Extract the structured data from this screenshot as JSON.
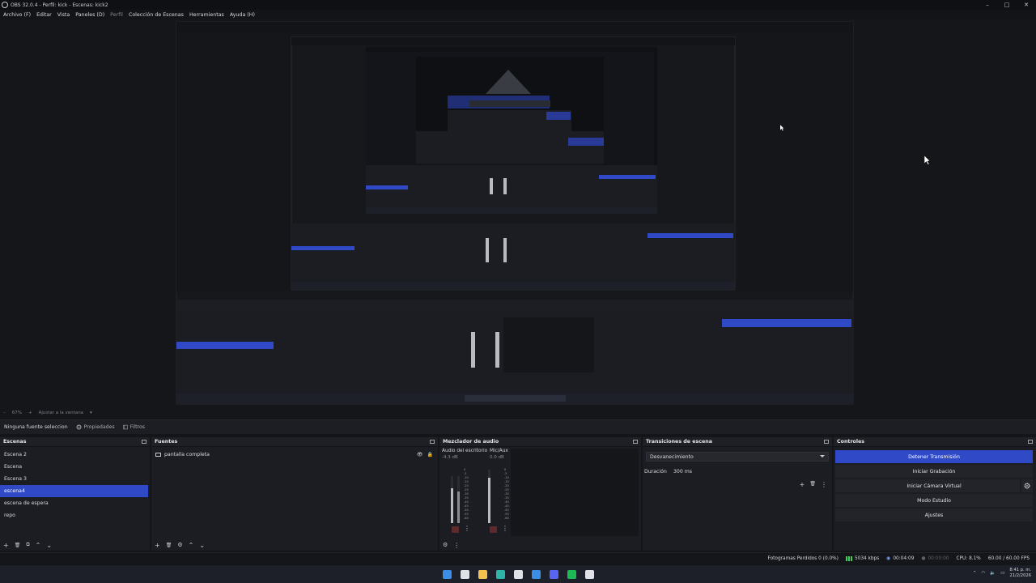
{
  "window": {
    "title": "OBS 32.0.4 - Perfil: kick - Escenas: kick2",
    "controls": {
      "minimize": "–",
      "maximize": "□",
      "close": "✕"
    }
  },
  "menu": {
    "items": [
      "Archivo (F)",
      "Editar",
      "Vista",
      "Paneles (D)",
      "Perfil",
      "Colección de Escenas",
      "Herramientas",
      "Ayuda (H)"
    ]
  },
  "preview_bar": {
    "zoom": "67%",
    "fit_label": "Ajustar a la ventana"
  },
  "context_bar": {
    "no_source": "Ninguna fuente seleccion",
    "properties": "Propiedades",
    "filters": "Filtros"
  },
  "scenes": {
    "title": "Escenas",
    "items": [
      {
        "label": "Escena 2",
        "selected": false
      },
      {
        "label": "Escena",
        "selected": false
      },
      {
        "label": "Escena 3",
        "selected": false
      },
      {
        "label": "escena4",
        "selected": true
      },
      {
        "label": "escena de espera",
        "selected": false
      },
      {
        "label": "repo",
        "selected": false
      }
    ],
    "footer": [
      "+",
      "🗑",
      "⧉",
      "⌃",
      "⌄"
    ]
  },
  "sources": {
    "title": "Fuentes",
    "items": [
      {
        "label": "pantalla completa",
        "icon": "monitor-icon"
      }
    ],
    "row_icons": [
      "👁",
      "🔒"
    ],
    "footer": [
      "+",
      "🗑",
      "⚙",
      "⌃",
      "⌄"
    ]
  },
  "mixer": {
    "title": "Mezclador de audio",
    "channels": [
      {
        "name": "Audio del escritorio",
        "db": "-4.3 dB",
        "level": 0.75
      },
      {
        "name": "Mic/Aux",
        "db": "0.0 dB",
        "level": 0.85
      }
    ],
    "scale": [
      "0",
      "-5",
      "-10",
      "-15",
      "-20",
      "-25",
      "-30",
      "-35",
      "-40",
      "-45",
      "-50",
      "-55",
      "-60"
    ],
    "footer": [
      "⚙",
      "⋮"
    ]
  },
  "transitions": {
    "title": "Transiciones de escena",
    "selected": "Desvanecimiento",
    "duration_label": "Duración",
    "duration_value": "300 ms",
    "tools": [
      "+",
      "🗑",
      "⋮"
    ]
  },
  "controls": {
    "title": "Controles",
    "buttons": [
      {
        "label": "Detener Transmisión",
        "primary": true
      },
      {
        "label": "Iniciar Grabación",
        "primary": false
      },
      {
        "label": "Iniciar Cámara Virtual",
        "primary": false,
        "gear": true
      },
      {
        "label": "Modo Estudio",
        "primary": false
      },
      {
        "label": "Ajustes",
        "primary": false
      }
    ]
  },
  "status": {
    "dropped": "Fotogramas Perdidos 0 (0.0%)",
    "bitrate": "5034 kbps",
    "stream_time": "00:04:09",
    "rec_time": "00:00:00",
    "cpu": "CPU: 8.1%",
    "fps": "60.00 / 60.00 FPS"
  },
  "taskbar": {
    "icons": [
      {
        "name": "windows-start-icon",
        "color": "#3a8ee6"
      },
      {
        "name": "search-icon",
        "color": "#e0e2e7"
      },
      {
        "name": "file-explorer-icon",
        "color": "#f2c14e"
      },
      {
        "name": "edge-icon",
        "color": "#2fb5a8"
      },
      {
        "name": "store-icon",
        "color": "#dfe1e6"
      },
      {
        "name": "mail-icon",
        "color": "#3a8ee6"
      },
      {
        "name": "discord-icon",
        "color": "#5865f2"
      },
      {
        "name": "spotify-icon",
        "color": "#1db954"
      },
      {
        "name": "obs-icon",
        "color": "#dfe1e6"
      }
    ],
    "time": "8:41 p. m.",
    "date": "21/2/2026"
  },
  "colors": {
    "accent": "#2f49c7",
    "background": "#141519",
    "panel": "#1c1d22"
  }
}
